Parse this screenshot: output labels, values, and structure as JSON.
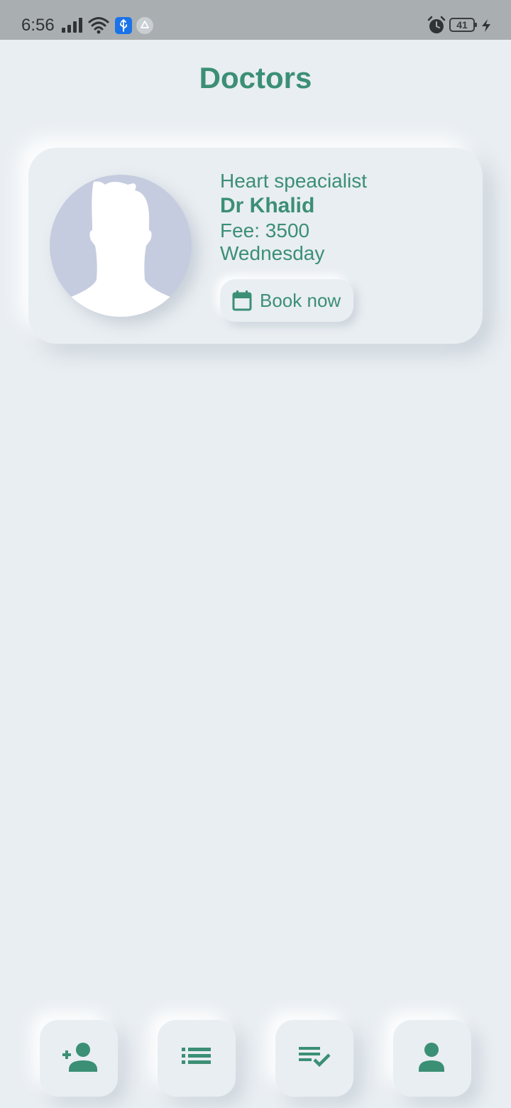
{
  "status_bar": {
    "time": "6:56",
    "battery_level": "41",
    "icons": [
      "signal-icon",
      "wifi-icon",
      "usb-icon",
      "drive-icon",
      "alarm-icon",
      "charging-icon"
    ]
  },
  "header": {
    "title": "Doctors"
  },
  "doctor_card": {
    "specialty": "Heart speacialist",
    "name": "Dr Khalid",
    "fee": "Fee: 3500",
    "day": "Wednesday",
    "book_label": "Book now",
    "book_icon": "calendar-icon",
    "avatar_icon": "person-silhouette-icon"
  },
  "bottom_nav": {
    "items": [
      {
        "icon": "add-person-icon"
      },
      {
        "icon": "list-icon"
      },
      {
        "icon": "checklist-icon"
      },
      {
        "icon": "person-icon"
      }
    ]
  },
  "colors": {
    "accent": "#3b8f74",
    "background": "#e9eef2",
    "status_bar": "#a9aeb1",
    "avatar_bg": "#c6ccdf"
  }
}
